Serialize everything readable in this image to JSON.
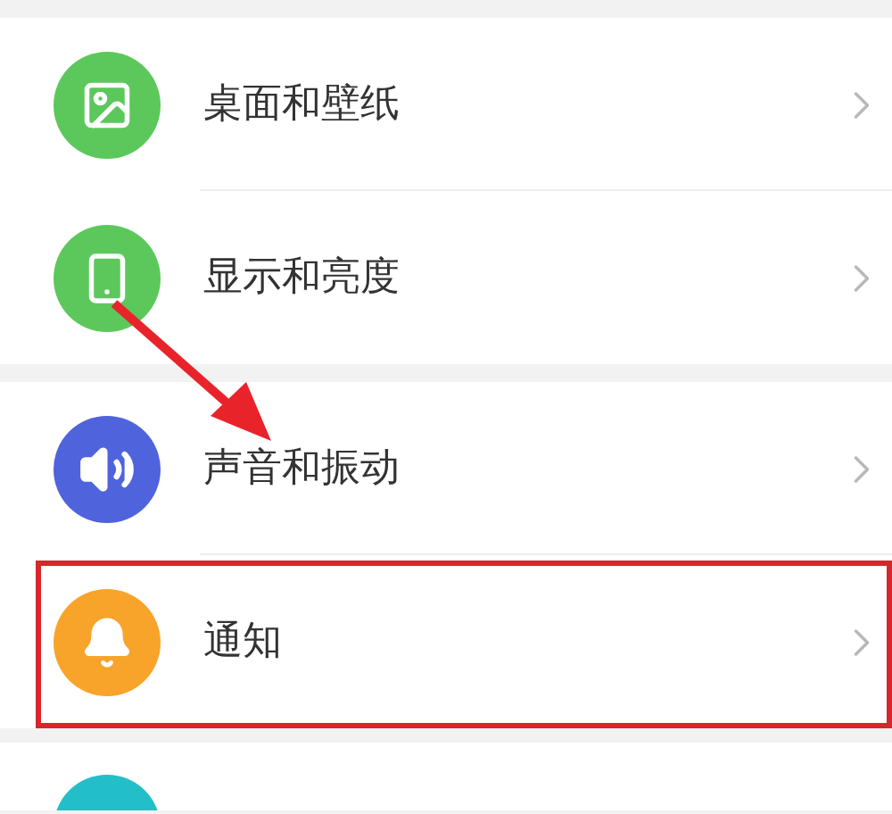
{
  "groups": [
    {
      "items": [
        {
          "label": "桌面和壁纸",
          "color": "#5cc85c",
          "highlighted": false
        },
        {
          "label": "显示和亮度",
          "color": "#5cc85c",
          "highlighted": false
        }
      ]
    },
    {
      "items": [
        {
          "label": "声音和振动",
          "color": "#4f63dc",
          "highlighted": false
        },
        {
          "label": "通知",
          "color": "#f8a42a",
          "highlighted": true
        }
      ]
    },
    {
      "items": [
        {
          "color": "#22bfc9",
          "highlighted": false
        }
      ]
    }
  ]
}
